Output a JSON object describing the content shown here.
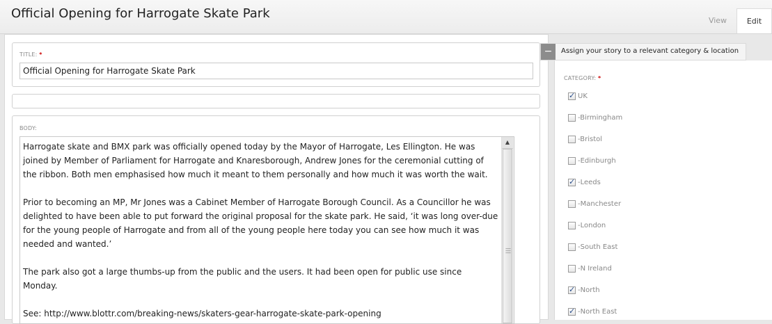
{
  "page": {
    "title": "Official Opening for Harrogate Skate Park"
  },
  "tabs": {
    "view": "View",
    "edit": "Edit"
  },
  "form": {
    "title_label": "TITLE:",
    "required_mark": "*",
    "title_value": "Official Opening for Harrogate Skate Park",
    "body_label": "BODY:",
    "body_paragraphs": [
      "Harrogate skate and BMX park was officially opened today by the Mayor of Harrogate, Les Ellington.  He was joined by Member of Parliament for Harrogate and Knaresborough, Andrew Jones for the ceremonial cutting of the ribbon.  Both men emphasised how much it meant to them personally and how much it was worth the wait.",
      "Prior to becoming an MP, Mr Jones was a Cabinet Member of Harrogate Borough Council.  As a Councillor he was delighted to have been able to put forward the original proposal for the skate park.  He said, ‘it was long over-due for the young people of Harrogate and from all of the young people here today you can see how much it was needed and wanted.’",
      "The park also got a large thumbs-up from the public and the users.  It had been open for public use since Monday.",
      "See: http://www.blottr.com/breaking-news/skaters-gear-harrogate-skate-park-opening"
    ]
  },
  "sidebar": {
    "collapse_symbol": "−",
    "header": "Assign your story to a relevant category & location",
    "category_label": "CATEGORY:",
    "required_mark": "*",
    "categories": [
      {
        "label": "UK",
        "checked": true
      },
      {
        "label": "-Birmingham",
        "checked": false
      },
      {
        "label": "-Bristol",
        "checked": false
      },
      {
        "label": "-Edinburgh",
        "checked": false
      },
      {
        "label": "-Leeds",
        "checked": true
      },
      {
        "label": "-Manchester",
        "checked": false
      },
      {
        "label": "-London",
        "checked": false
      },
      {
        "label": "-South East",
        "checked": false
      },
      {
        "label": "-N Ireland",
        "checked": false
      },
      {
        "label": "-North",
        "checked": true
      },
      {
        "label": "-North East",
        "checked": true
      }
    ]
  },
  "colors": {
    "required": "#cc0000",
    "checkmark": "#2a4e8a",
    "collapse_button": "#8c8c8c"
  }
}
